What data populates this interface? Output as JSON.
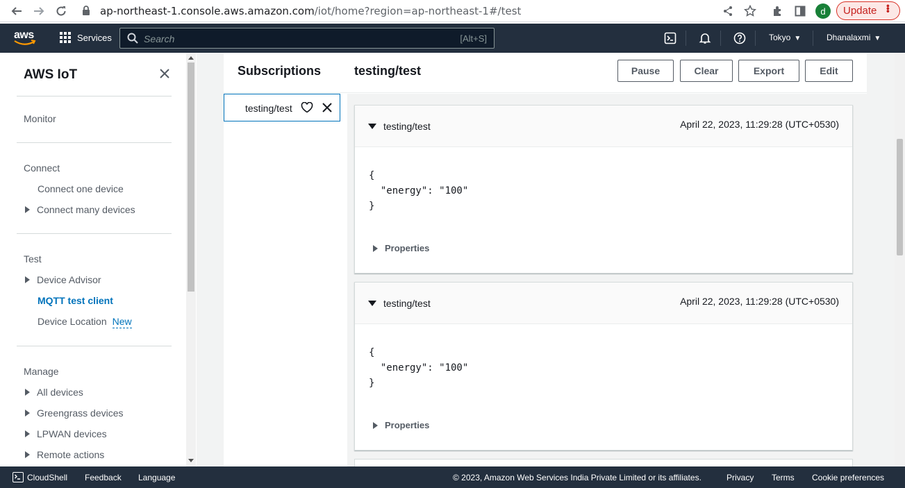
{
  "browser": {
    "url_host": "ap-northeast-1.console.aws.amazon.com",
    "url_path": "/iot/home?region=ap-northeast-1#/test",
    "avatar_letter": "d",
    "update_label": "Update"
  },
  "aws_nav": {
    "logo": "aws",
    "services_label": "Services",
    "search_placeholder": "Search",
    "search_shortcut": "[Alt+S]",
    "region": "Tokyo",
    "user": "Dhanalaxmi"
  },
  "sidebar": {
    "title": "AWS IoT",
    "sections": [
      {
        "label": "Monitor"
      },
      {
        "label": "Connect",
        "items": [
          "Connect one device",
          "Connect many devices"
        ]
      },
      {
        "label": "Test",
        "items": [
          "Device Advisor",
          "MQTT test client",
          "Device Location"
        ],
        "new_badge": "New"
      },
      {
        "label": "Manage",
        "items": [
          "All devices",
          "Greengrass devices",
          "LPWAN devices",
          "Remote actions"
        ]
      }
    ]
  },
  "main": {
    "subscriptions_title": "Subscriptions",
    "topic_title": "testing/test",
    "buttons": {
      "pause": "Pause",
      "clear": "Clear",
      "export": "Export",
      "edit": "Edit"
    },
    "subscription": "testing/test",
    "messages": [
      {
        "topic": "testing/test",
        "timestamp": "April 22, 2023, 11:29:28 (UTC+0530)",
        "payload_open": "{",
        "payload_line": "  \"energy\": \"100\"",
        "payload_close": "}",
        "properties_label": "Properties"
      },
      {
        "topic": "testing/test",
        "timestamp": "April 22, 2023, 11:29:28 (UTC+0530)",
        "payload_open": "{",
        "payload_line": "  \"energy\": \"100\"",
        "payload_close": "}",
        "properties_label": "Properties"
      }
    ]
  },
  "footer": {
    "cloudshell": "CloudShell",
    "feedback": "Feedback",
    "language": "Language",
    "copyright": "© 2023, Amazon Web Services India Private Limited or its affiliates.",
    "privacy": "Privacy",
    "terms": "Terms",
    "cookies": "Cookie preferences"
  }
}
